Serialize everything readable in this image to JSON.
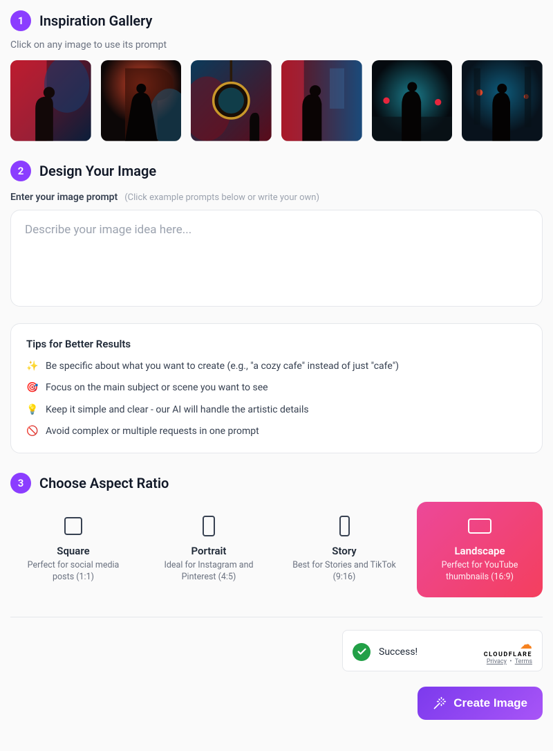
{
  "section1": {
    "step": "1",
    "title": "Inspiration Gallery",
    "subtitle": "Click on any image to use its prompt"
  },
  "section2": {
    "step": "2",
    "title": "Design Your Image",
    "promptLabel": "Enter your image prompt",
    "promptHint": "(Click example prompts below or write your own)",
    "placeholder": "Describe your image idea here..."
  },
  "tips": {
    "title": "Tips for Better Results",
    "items": [
      {
        "emoji": "✨",
        "text": "Be specific about what you want to create (e.g., \"a cozy cafe\" instead of just \"cafe\")"
      },
      {
        "emoji": "🎯",
        "text": "Focus on the main subject or scene you want to see"
      },
      {
        "emoji": "💡",
        "text": "Keep it simple and clear - our AI will handle the artistic details"
      },
      {
        "emoji": "🚫",
        "text": "Avoid complex or multiple requests in one prompt"
      }
    ]
  },
  "section3": {
    "step": "3",
    "title": "Choose Aspect Ratio"
  },
  "ratios": [
    {
      "name": "Square",
      "desc": "Perfect for social media posts (1:1)",
      "selected": false,
      "shape": "square"
    },
    {
      "name": "Portrait",
      "desc": "Ideal for Instagram and Pinterest (4:5)",
      "selected": false,
      "shape": "portrait"
    },
    {
      "name": "Story",
      "desc": "Best for Stories and TikTok (9:16)",
      "selected": false,
      "shape": "story"
    },
    {
      "name": "Landscape",
      "desc": "Perfect for YouTube thumbnails (16:9)",
      "selected": true,
      "shape": "landscape"
    }
  ],
  "captcha": {
    "status": "Success!",
    "brand": "CLOUDFLARE",
    "privacy": "Privacy",
    "terms": "Terms"
  },
  "createButton": "Create Image",
  "colors": {
    "accent": "#8b3dff",
    "gradientPink": "#ec4899",
    "gradientPurple": "#7c3aed"
  }
}
